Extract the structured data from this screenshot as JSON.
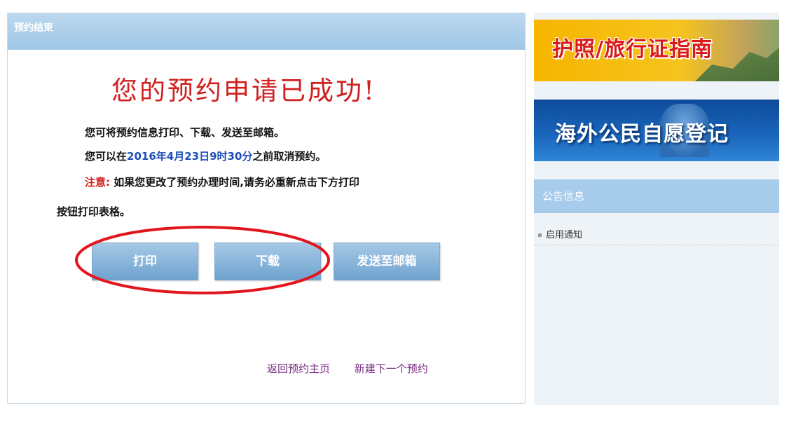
{
  "panel": {
    "header": "预约结束",
    "success_title": "您的预约申请已成功!",
    "line1": "您可将预约信息打印、下载、发送至邮箱。",
    "line2_prefix": "您可以在",
    "line2_datetime": "2016年4月23日9时30分",
    "line2_suffix": "之前取消预约。",
    "line3_note": "注意:",
    "line3_text": "如果您更改了预约办理时间,请务必重新点击下方打印",
    "line4": "按钮打印表格。",
    "buttons": {
      "print": "打印",
      "download": "下载",
      "email": "发送至邮箱"
    },
    "links": {
      "back_home": "返回预约主页",
      "new_booking": "新建下一个预约"
    }
  },
  "sidebar": {
    "banner1": "护照/旅行证指南",
    "banner2": "海外公民自愿登记",
    "notice_header": "公告信息",
    "notices": [
      "启用通知"
    ]
  },
  "colors": {
    "accent_red": "#d01f1f",
    "header_blue": "#9fc6e6",
    "link_purple": "#7a2f82",
    "date_blue": "#1d4fb8"
  }
}
